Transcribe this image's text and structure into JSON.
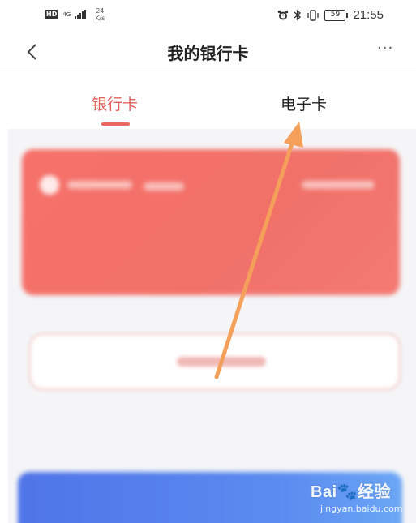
{
  "status_bar": {
    "hd": "HD",
    "net_type": "4G",
    "speed_value": "24",
    "speed_unit": "K/s",
    "battery": "59",
    "time": "21:55"
  },
  "header": {
    "title": "我的银行卡",
    "more": "···"
  },
  "tabs": [
    {
      "label": "银行卡",
      "active": true
    },
    {
      "label": "电子卡",
      "active": false
    }
  ],
  "colors": {
    "accent": "#e2615b",
    "card_red": "#f37069",
    "card_blue": "#5b8cf0",
    "arrow": "#f4a05a"
  },
  "watermark": {
    "brand": "Bai🐾经验",
    "url": "jingyan.baidu.com"
  }
}
